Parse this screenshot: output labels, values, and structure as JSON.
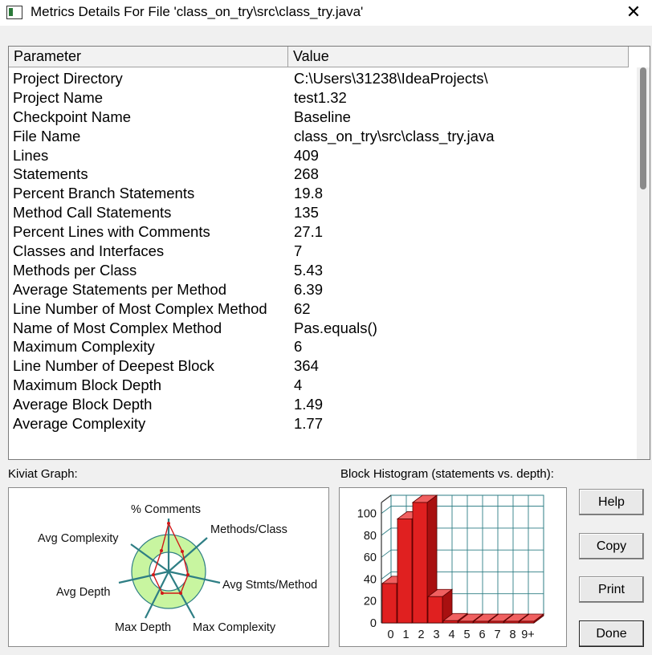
{
  "window": {
    "title": "Metrics Details For File 'class_on_try\\src\\class_try.java'",
    "close_glyph": "✕"
  },
  "table": {
    "headers": {
      "parameter": "Parameter",
      "value": "Value"
    },
    "rows": [
      {
        "parameter": "Project Directory",
        "value": "C:\\Users\\31238\\IdeaProjects\\"
      },
      {
        "parameter": "Project Name",
        "value": "test1.32"
      },
      {
        "parameter": "Checkpoint Name",
        "value": "Baseline"
      },
      {
        "parameter": "File Name",
        "value": "class_on_try\\src\\class_try.java"
      },
      {
        "parameter": "Lines",
        "value": "409"
      },
      {
        "parameter": "Statements",
        "value": "268"
      },
      {
        "parameter": "Percent Branch Statements",
        "value": "19.8"
      },
      {
        "parameter": "Method Call Statements",
        "value": "135"
      },
      {
        "parameter": "Percent Lines with Comments",
        "value": "27.1"
      },
      {
        "parameter": "Classes and Interfaces",
        "value": "7"
      },
      {
        "parameter": "Methods per Class",
        "value": "5.43"
      },
      {
        "parameter": "Average Statements per Method",
        "value": "6.39"
      },
      {
        "parameter": "Line Number of Most Complex Method",
        "value": "62"
      },
      {
        "parameter": "Name of Most Complex Method",
        "value": "Pas.equals()"
      },
      {
        "parameter": "Maximum Complexity",
        "value": "6"
      },
      {
        "parameter": "Line Number of Deepest Block",
        "value": "364"
      },
      {
        "parameter": "Maximum Block Depth",
        "value": "4"
      },
      {
        "parameter": "Average Block Depth",
        "value": "1.49"
      },
      {
        "parameter": "Average Complexity",
        "value": "1.77"
      }
    ]
  },
  "kiviat": {
    "label": "Kiviat Graph:",
    "axes": {
      "comments": "% Comments",
      "methods_class": "Methods/Class",
      "avg_stmts": "Avg Stmts/Method",
      "max_complexity": "Max Complexity",
      "max_depth": "Max Depth",
      "avg_depth": "Avg Depth",
      "avg_complexity": "Avg Complexity"
    },
    "colors": {
      "ring": "#c8f5a0",
      "spoke": "#2e7e84",
      "polygon": "#d01818"
    }
  },
  "histogram": {
    "label": "Block Histogram (statements vs. depth):",
    "y_ticks": [
      "0",
      "20",
      "40",
      "60",
      "80",
      "100"
    ],
    "x_ticks": [
      "0",
      "1",
      "2",
      "3",
      "4",
      "5",
      "6",
      "7",
      "8",
      "9+"
    ]
  },
  "chart_data": {
    "type": "bar",
    "categories": [
      "0",
      "1",
      "2",
      "3",
      "4",
      "5",
      "6",
      "7",
      "8",
      "9+"
    ],
    "values": [
      36,
      95,
      110,
      24,
      2,
      0,
      0,
      0,
      0,
      0
    ],
    "ylim": [
      0,
      110
    ],
    "grid": true,
    "bar_color": "#e02020"
  },
  "buttons": {
    "help": "Help",
    "copy": "Copy",
    "print": "Print",
    "done": "Done"
  }
}
